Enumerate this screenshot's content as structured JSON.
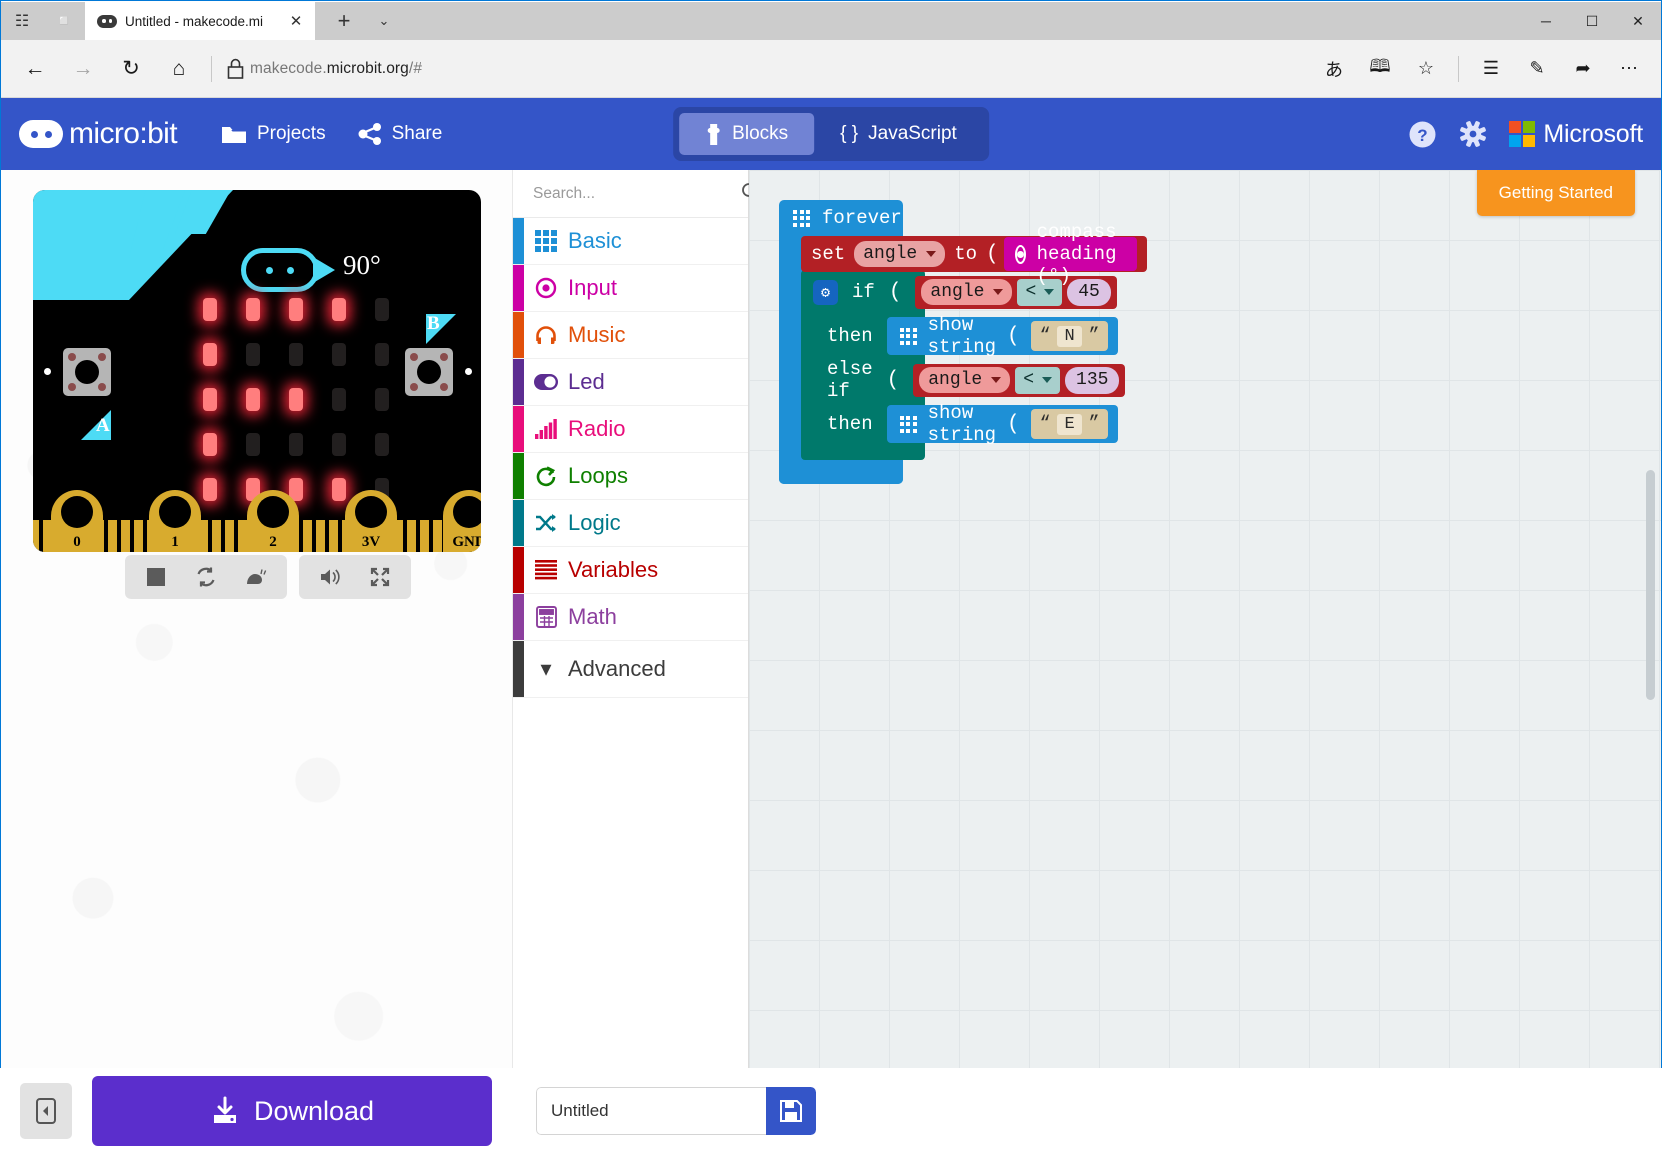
{
  "browser": {
    "tab": {
      "title": "Untitled - makecode.mi",
      "favicon": "microbit-favicon",
      "close": "✕"
    },
    "newtab_label": "+",
    "tab_menu": "⌄",
    "window": {
      "minimize": "─",
      "maximize": "☐",
      "close": "✕"
    },
    "nav": {
      "back": "←",
      "forward": "→",
      "refresh": "↻",
      "home": "⌂"
    },
    "address": {
      "domain_prefix": "makecode.",
      "domain_bold": "microbit.org",
      "path": "/#",
      "lock": "lock-icon"
    },
    "toolbar_right": [
      "translate-icon",
      "reading-view-icon",
      "favorites-star-icon",
      "hub-icon",
      "web-notes-icon",
      "share-icon",
      "settings-more-icon"
    ]
  },
  "header": {
    "logo_text": "micro:bit",
    "menu": [
      {
        "label": "Projects",
        "icon": "folder-icon"
      },
      {
        "label": "Share",
        "icon": "share-icon"
      }
    ],
    "editor_switch": [
      {
        "label": "Blocks",
        "icon": "puzzle-icon",
        "active": true
      },
      {
        "label": "JavaScript",
        "icon": "braces-icon",
        "active": false
      }
    ],
    "help_icon": "question-circle-icon",
    "settings_icon": "gear-icon",
    "microsoft_label": "Microsoft",
    "accent_blue": "#3455c8",
    "switch_bg": "#2b46a5",
    "switch_active": "#7183d4"
  },
  "simulator": {
    "heading_label": "90°",
    "button_a_label": "A",
    "button_b_label": "B",
    "pin_labels": [
      "0",
      "1",
      "2",
      "3V",
      "GND"
    ],
    "led_matrix": [
      [
        1,
        1,
        1,
        1,
        0
      ],
      [
        1,
        0,
        0,
        0,
        0
      ],
      [
        1,
        1,
        1,
        0,
        0
      ],
      [
        1,
        0,
        0,
        0,
        0
      ],
      [
        1,
        1,
        1,
        1,
        0
      ]
    ],
    "led_on_color": "#ff7e7e",
    "led_off_color": "#221f1f",
    "board_accent": "#4ddbf5",
    "pin_color": "#d8ab2e",
    "controls": [
      {
        "name": "stop-button",
        "glyph": "■"
      },
      {
        "name": "restart-button",
        "glyph": "⟳"
      },
      {
        "name": "slow-motion-button",
        "glyph": "🐌"
      },
      {
        "name": "mute-button",
        "glyph": "🔊"
      },
      {
        "name": "fullscreen-button",
        "glyph": "⤡"
      }
    ]
  },
  "toolbox": {
    "search_placeholder": "Search...",
    "search_value": "",
    "search_icon": "magnifier-icon",
    "categories": [
      {
        "label": "Basic",
        "color": "#1e90d6",
        "icon": "grid-icon"
      },
      {
        "label": "Input",
        "color": "#cc00a5",
        "icon": "target-icon"
      },
      {
        "label": "Music",
        "color": "#e1500a",
        "icon": "headphones-icon"
      },
      {
        "label": "Led",
        "color": "#5c2d91",
        "icon": "toggle-icon"
      },
      {
        "label": "Radio",
        "color": "#e80e7b",
        "icon": "signal-bars-icon"
      },
      {
        "label": "Loops",
        "color": "#0f8000",
        "icon": "loop-arrow-icon"
      },
      {
        "label": "Logic",
        "color": "#00798a",
        "icon": "shuffle-icon"
      },
      {
        "label": "Variables",
        "color": "#b80000",
        "icon": "lines-icon"
      },
      {
        "label": "Math",
        "color": "#8c3f9e",
        "icon": "calculator-icon"
      }
    ],
    "advanced": {
      "label": "Advanced",
      "color": "#3c3c3c",
      "icon": "chevron-down-icon"
    }
  },
  "workspace": {
    "getting_started_label": "Getting Started",
    "getting_started_color": "#f7941e",
    "blocks": {
      "forever": {
        "label": "forever",
        "color": "#1e90d6"
      },
      "set": {
        "keyword": "set",
        "variable": "angle",
        "to": "to",
        "color": "#b32025"
      },
      "compass": {
        "label": "compass heading (°)",
        "color": "#cc00a5"
      },
      "if_block": {
        "if_label": "if",
        "then_label": "then",
        "else_if_label": "else if",
        "then2_label": "then",
        "color": "#00796b",
        "cond1": {
          "variable": "angle",
          "operator": "<",
          "value": "45"
        },
        "cond2": {
          "variable": "angle",
          "operator": "<",
          "value": "135"
        }
      },
      "show_string_1": {
        "label": "show string",
        "value": "N",
        "quote_open": "“",
        "quote_close": "”"
      },
      "show_string_2": {
        "label": "show string",
        "value": "E",
        "quote_open": "“",
        "quote_close": "”"
      }
    },
    "bottom_buttons": [
      {
        "name": "undo-button",
        "glyph": "↶"
      },
      {
        "name": "redo-button",
        "glyph": "↷"
      },
      {
        "name": "zoom-in-button",
        "glyph": "＋"
      },
      {
        "name": "zoom-out-button",
        "glyph": "－"
      }
    ]
  },
  "footer": {
    "collapse_label": "◀",
    "download_label": "Download",
    "download_icon": "download-icon",
    "download_color": "#5b2ecc",
    "project_name_value": "Untitled",
    "project_name_placeholder": "Untitled",
    "save_icon": "floppy-disk-icon"
  }
}
